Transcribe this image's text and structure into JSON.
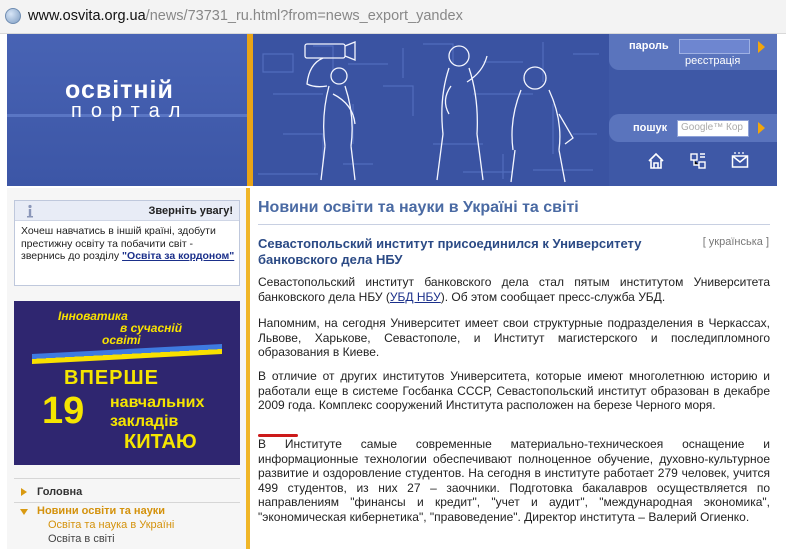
{
  "browser": {
    "url_host": "www.osvita.org.ua",
    "url_path": "/news/73731_ru.html?from=news_export_yandex"
  },
  "header": {
    "logo_title": "освітній",
    "logo_subtitle": "портал",
    "password_label": "пароль",
    "register_link": "реєстрація",
    "search_label": "пошук",
    "search_placeholder": "Google™ Кор",
    "icons": [
      "home-icon",
      "sitemap-icon",
      "mail-icon"
    ]
  },
  "sidebar": {
    "notice": {
      "heading": "Зверніть увагу!",
      "text": "Хочеш навчатись в іншій країні, здобути престижну освіту та побачити світ - звернись до розділу",
      "link": "\"Освіта за кордоном\""
    },
    "ad": {
      "ribbon_line1": "Інноватика",
      "ribbon_line2": "в сучасній",
      "ribbon_line3": "освіті",
      "line1": "ВПЕРШЕ",
      "number": "19",
      "line2a": "навчальних",
      "line2b": "закладів",
      "line3": "КИТАЮ",
      "colors": {
        "background": "#2f2670",
        "text": "#f5e500"
      }
    },
    "menu": [
      {
        "label": "Головна",
        "level": 0,
        "active": false
      },
      {
        "label": "Новини освіти та науки",
        "level": 0,
        "active": true
      },
      {
        "label": "Освіта та наука в Україні",
        "level": 1,
        "active": true
      },
      {
        "label": "Освіта в світі",
        "level": 1,
        "active": false
      }
    ]
  },
  "main": {
    "section_title": "Новини освіти та науки в Україні та світі",
    "article_title": "Севастопольский институт присоединился к Университету банковского дела НБУ",
    "language_link": "[ українська ]",
    "paragraphs": [
      {
        "before": "Севастопольский институт банковского дела стал пятым институтом Университета банковского дела НБУ (",
        "link": "УБД НБУ",
        "after": "). Об этом сообщает пресс-служба УБД."
      },
      {
        "text": "Напомним, на сегодня Университет имеет свои структурные подразделения в Черкассах, Львове, Харькове, Севастополе, и Институт магистерского и последипломного образования в Киеве."
      },
      {
        "text": "В отличие от других институтов Университета, которые имеют многолетнюю историю и работали еще в системе Госбанка СССР, Севастопольский институт образован в декабре 2009 года. Комплекс сооружений Института расположен на березе Черного моря."
      },
      {
        "text": "В Институте самые современные материально-техническоея оснащение и информационные технологии обеспечивают полноценное обучение, духовно-культурное развитие и оздоровление студентов. На сегодня в институте работает 279 человек, учится 499 студентов, из них 27 – заочники. Подготовка бакалавров осуществляется по направлениям \"финансы и кредит\", \"учет и аудит\", \"международная экономика\", \"экономическая кибернетика\", \"правоведение\". Директор института – Валерий Огиенко."
      }
    ]
  },
  "colors": {
    "banner": "#3d57a3",
    "accent": "#e9a415",
    "title_blue": "#4a6aa3",
    "link": "#1a2f8a"
  }
}
